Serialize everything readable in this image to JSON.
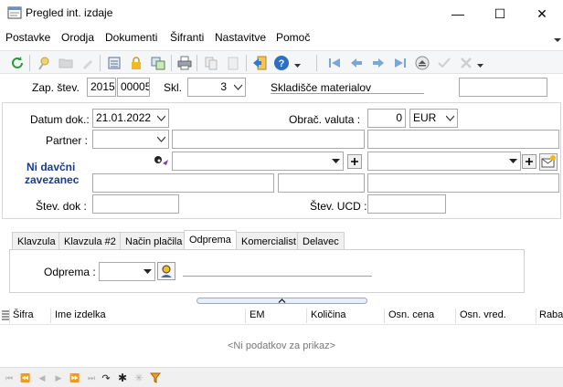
{
  "window": {
    "title": "Pregled int. izdaje",
    "minimize": "—",
    "maximize": "☐",
    "close": "✕"
  },
  "menu": {
    "items": [
      "Postavke",
      "Orodja",
      "Dokumenti",
      "Šifranti",
      "Nastavitve",
      "Pomoč"
    ]
  },
  "header": {
    "zap_label": "Zap. štev.",
    "year": "2015",
    "number": "00005",
    "skl_label": "Skl.",
    "skl_value": "3",
    "warehouse_name": "Skladišče materialov",
    "extra_value": ""
  },
  "form": {
    "datum_label": "Datum dok.:",
    "datum_value": "21.01.2022",
    "valuta_label": "Obrač. valuta :",
    "valuta_rate": "0",
    "valuta_code": "EUR",
    "partner_label": "Partner :",
    "partner_value": "",
    "ni_davcni_line1": "Ni davčni",
    "ni_davcni_line2": "zavezanec",
    "stev_dok_label": "Štev. dok :",
    "stev_ucd_label": "Štev. UCD :"
  },
  "tabs": {
    "items": [
      "Klavzula",
      "Klavzula #2",
      "Način plačila",
      "Odprema",
      "Komercialist",
      "Delavec"
    ],
    "active_index": 3
  },
  "odprema": {
    "label": "Odprema :",
    "value": ""
  },
  "grid": {
    "columns": [
      "Šifra",
      "Ime izdelka",
      "EM",
      "Količina",
      "Osn. cena",
      "Osn. vred.",
      "Rabat"
    ],
    "empty_text": "<Ni podatkov za prikaz>"
  },
  "colors": {
    "accent_blue": "#1a3a8c",
    "toolbar_bg": "#f5f6f7",
    "border": "#a9a9a9"
  },
  "icons": {
    "refresh": "refresh-icon",
    "new": "new-icon",
    "open": "folder-icon",
    "edit": "pencil-icon",
    "calc": "calculator-icon",
    "lock": "lock-icon",
    "copy": "copy-icon",
    "print": "printer-icon",
    "help": "help-icon",
    "exit": "exit-icon"
  }
}
